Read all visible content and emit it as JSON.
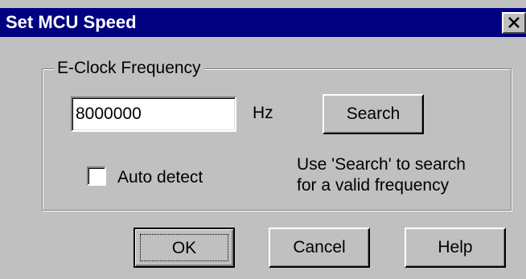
{
  "dialog": {
    "title": "Set MCU Speed",
    "close_icon": "close-x-icon",
    "colors": {
      "titlebar": "#000080",
      "face": "#c0c0c0"
    }
  },
  "group": {
    "label": "E-Clock Frequency",
    "frequency_value": "8000000",
    "unit": "Hz",
    "search_label": "Search",
    "auto_detect_label": "Auto detect",
    "auto_detect_checked": false,
    "hint_line1": "Use 'Search' to search",
    "hint_line2": "for a valid frequency"
  },
  "buttons": {
    "ok_label": "OK",
    "cancel_label": "Cancel",
    "help_label": "Help"
  }
}
